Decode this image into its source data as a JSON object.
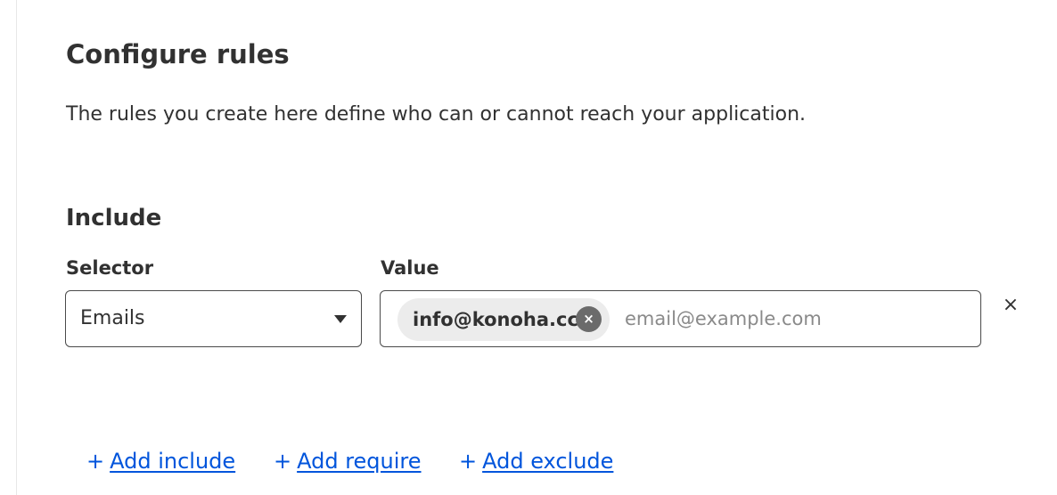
{
  "page": {
    "title": "Configure rules",
    "description": "The rules you create here define who can or cannot reach your application."
  },
  "include": {
    "title": "Include",
    "selector_label": "Selector",
    "value_label": "Value",
    "selector_value": "Emails",
    "chips": [
      "info@konoha.cc"
    ],
    "chip_remove_glyph": "×",
    "value_placeholder": "email@example.com",
    "remove_row_glyph": "×"
  },
  "actions": {
    "plus_glyph": "+",
    "add_include": "Add include",
    "add_require": "Add require",
    "add_exclude": "Add exclude"
  },
  "colors": {
    "text": "#313131",
    "link": "#0055dc",
    "chip_bg": "#ececec",
    "chip_remove_bg": "#6b6b6b"
  },
  "icons": {
    "dropdown": "caret-down-icon",
    "chip_remove": "close-circle-icon",
    "remove_row": "close-icon",
    "add": "plus-icon"
  }
}
